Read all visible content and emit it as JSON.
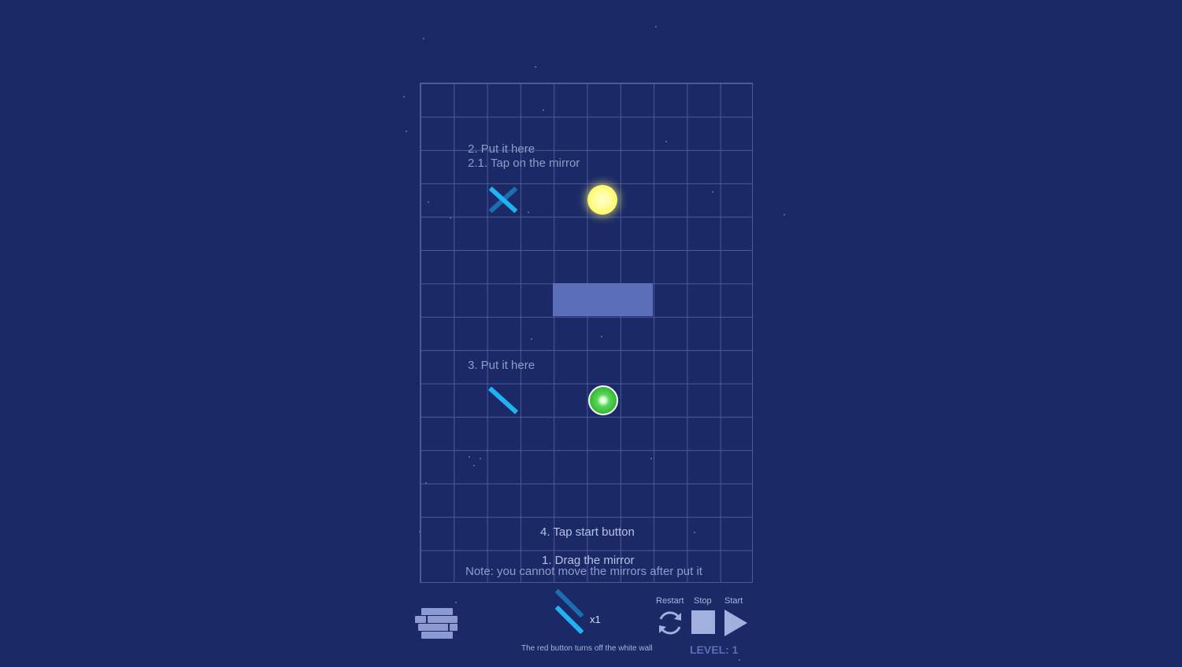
{
  "hints": {
    "step2": "2. Put it here",
    "step2_1": "2.1. Tap on the mirror",
    "step3": "3. Put it here",
    "step4": "4. Tap start button",
    "step1": "1. Drag the mirror",
    "note": "Note: you cannot move the mirrors after put it"
  },
  "inventory": {
    "icon": "double-mirror-icon",
    "count": "x1"
  },
  "controls": {
    "restart_label": "Restart",
    "stop_label": "Stop",
    "start_label": "Start"
  },
  "footer": {
    "tip": "The red button turns off the white wall",
    "level": "LEVEL: 1"
  },
  "colors": {
    "background": "#1b2a66",
    "grid_line": "#4a5a9c",
    "wall": "#5a6fb8",
    "mirror": "#1fb3f0",
    "mirror_dark": "#1a6fb0",
    "sun": "#fffb80",
    "target": "#33b833"
  },
  "icons": {
    "menu": "bricks-menu-icon",
    "restart": "restart-icon",
    "stop": "stop-icon",
    "start": "play-icon"
  }
}
